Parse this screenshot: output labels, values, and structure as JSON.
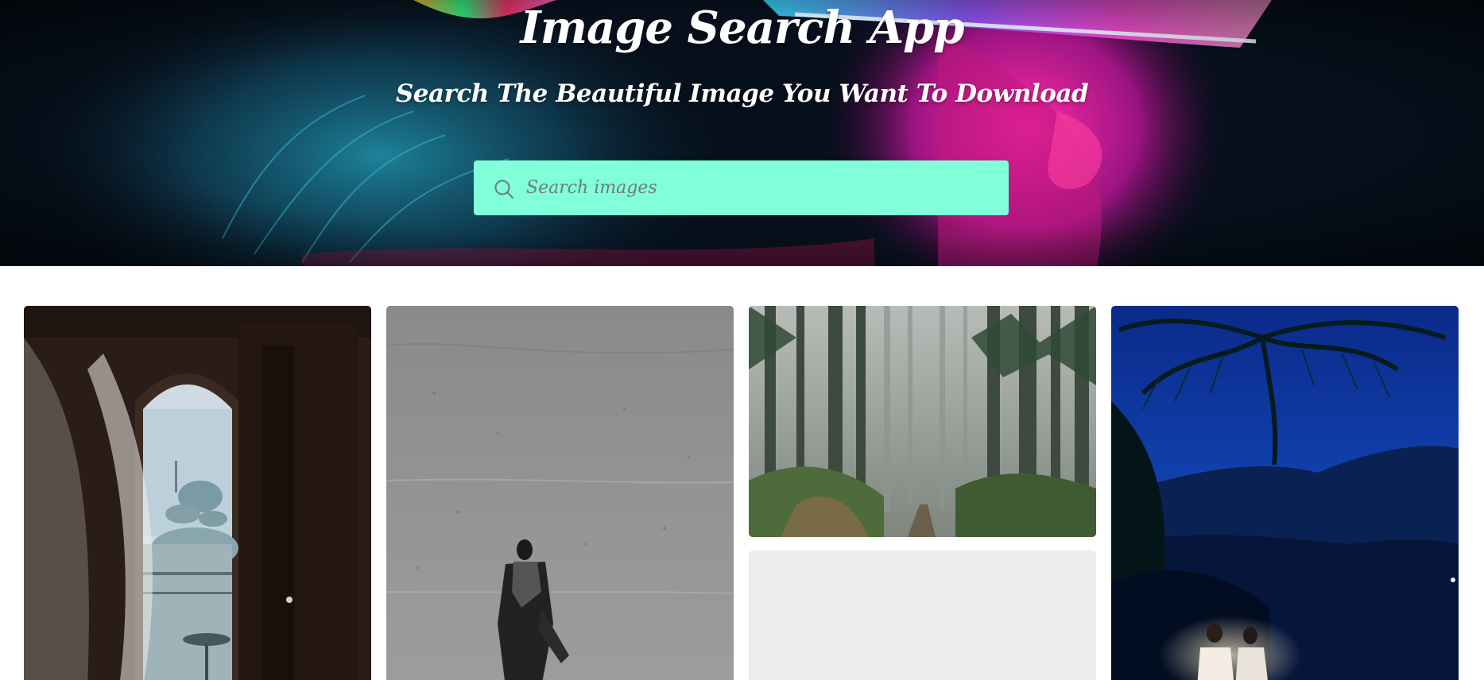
{
  "header": {
    "title": "Image Search App",
    "subtitle": "Search The Beautiful Image You Want To Download"
  },
  "search": {
    "placeholder": "Search images",
    "value": "",
    "icon": "search-icon",
    "background_color": "#80ffd9"
  },
  "gallery": {
    "images": [
      {
        "name": "mosque-window-photo"
      },
      {
        "name": "man-on-beach-photo"
      },
      {
        "name": "foggy-forest-photo"
      },
      {
        "name": "loading-placeholder"
      },
      {
        "name": "night-palm-couple-photo"
      }
    ]
  }
}
